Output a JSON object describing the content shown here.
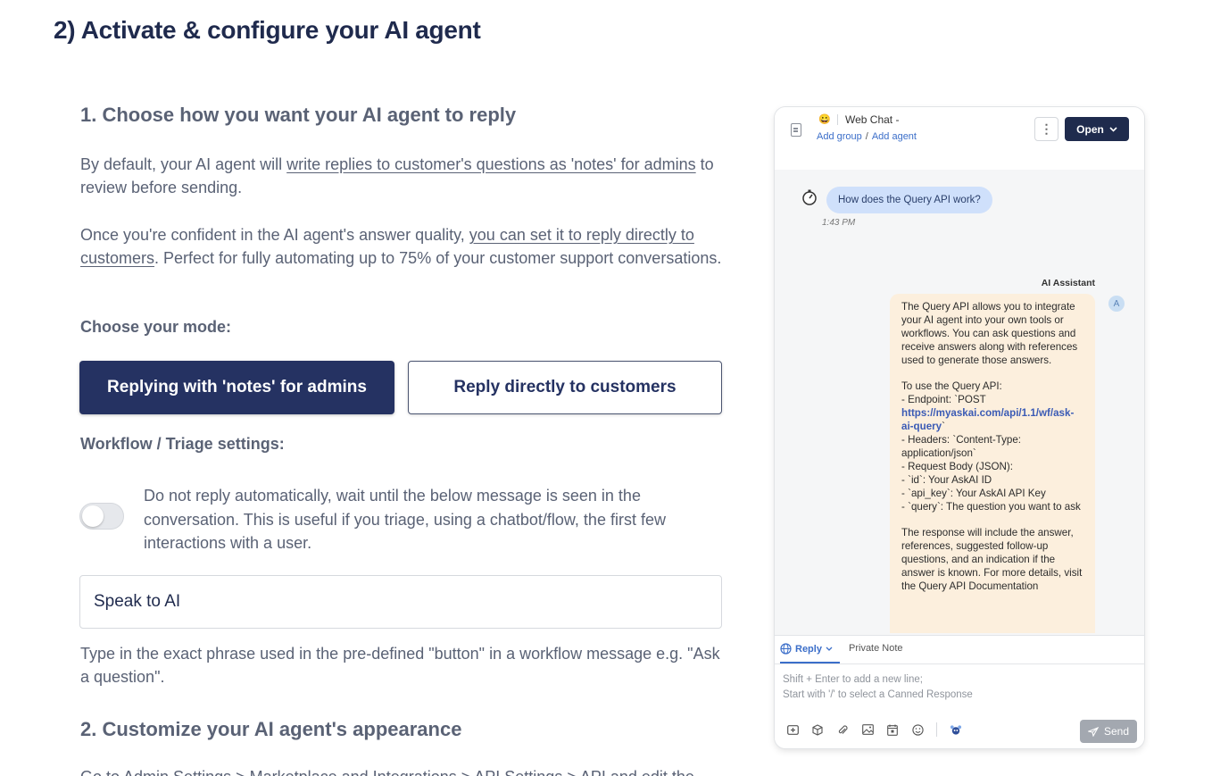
{
  "page": {
    "title": "2) Activate & configure your AI agent"
  },
  "section1": {
    "heading": "1. Choose how you want your AI agent to reply",
    "para1_pre": "By default, your AI agent will ",
    "para1_link": "write replies to customer's questions as 'notes' for admins",
    "para1_post": " to review before sending.",
    "para2_pre": "Once you're confident in the AI agent's answer quality, ",
    "para2_link": "you can set it to reply directly to customers",
    "para2_post": ". Perfect for fully automating up to 75% of your customer support conversations.",
    "mode_label": "Choose your mode:",
    "mode_notes_button": "Replying with 'notes' for admins",
    "mode_direct_button": "Reply directly to customers",
    "workflow_label": "Workflow / Triage settings:",
    "toggle_text": "Do not reply automatically, wait until the below message is seen in the conversation. This is useful if you triage, using a chatbot/flow, the first few interactions with a user.",
    "phrase_value": "Speak to AI",
    "phrase_help": "Type in the exact phrase used in the pre-defined \"button\" in a workflow message e.g. \"Ask a question\"."
  },
  "section2": {
    "heading": "2. Customize your AI agent's appearance",
    "cut_text": "Go to Admin Settings > Marketplace and Integrations > API Settings > API and edit the"
  },
  "preview": {
    "header": {
      "emoji": "😀",
      "channel": "Web Chat -",
      "add_group": "Add group",
      "separator": "/",
      "add_agent": "Add agent",
      "kebab": "⋮",
      "open_button": "Open"
    },
    "user_message": "How does the Query API work?",
    "user_time": "1:43 PM",
    "ai_name": "AI Assistant",
    "ai_avatar": "A",
    "ai_text_1": "The Query API allows you to integrate your AI agent into your own tools or workflows. You can ask questions and receive answers along with references used to generate those answers.\n\nTo use the Query API:\n- Endpoint: `POST ",
    "ai_link": "https://myaskai.com/api/1.1/wf/ask-ai-query",
    "ai_text_2": "`\n- Headers: `Content-Type: application/json`\n- Request Body (JSON):\n- `id`: Your AskAI ID\n- `api_key`: Your AskAI API Key\n- `query`: The question you want to ask\n\nThe response will include the answer, references, suggested follow-up questions, and an indication if the answer is known. For more details, visit the Query API Documentation",
    "composer": {
      "tab_reply": "Reply",
      "tab_private": "Private Note",
      "placeholder_1": "Shift + Enter to add a new line;",
      "placeholder_2": "Start with '/' to select a Canned Response",
      "send_button": "Send"
    }
  },
  "colors": {
    "primary_navy": "#253262",
    "body_text": "#5a6275",
    "link_blue": "#3b6ec9",
    "ai_bubble": "#fcefdd",
    "user_bubble": "#cfe0fb"
  }
}
